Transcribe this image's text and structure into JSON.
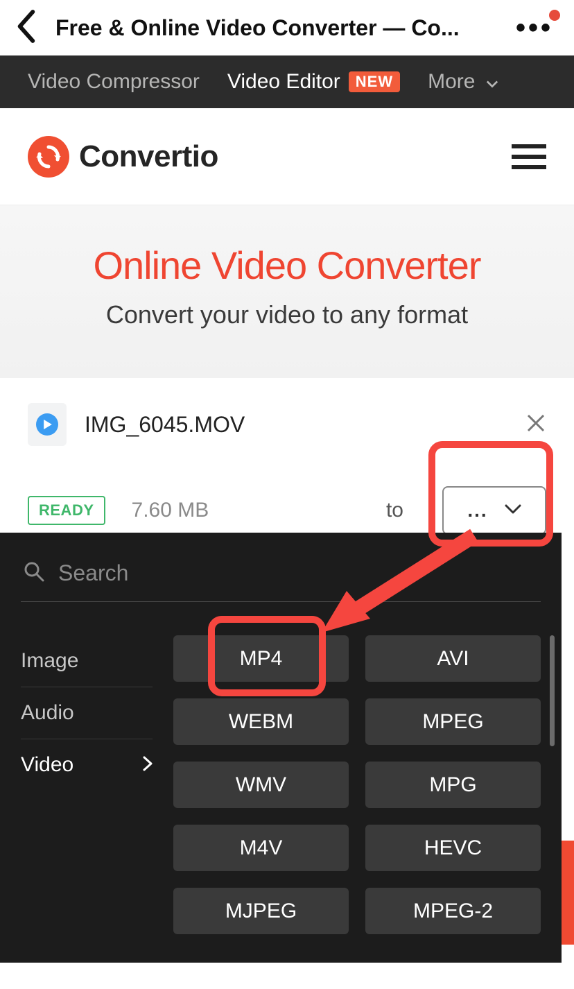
{
  "browser": {
    "title": "Free & Online Video Converter — Co..."
  },
  "topnav": {
    "item_compressor": "Video Compressor",
    "item_editor": "Video Editor",
    "badge_new": "NEW",
    "item_more": "More"
  },
  "brand": {
    "name": "Convertio"
  },
  "hero": {
    "title": "Online Video Converter",
    "subtitle": "Convert your video to any format"
  },
  "file": {
    "name": "IMG_6045.MOV",
    "status": "READY",
    "size": "7.60 MB",
    "to_label": "to",
    "select_value": "..."
  },
  "format_panel": {
    "search_placeholder": "Search",
    "categories": {
      "image": "Image",
      "audio": "Audio",
      "video": "Video"
    },
    "formats": {
      "mp4": "MP4",
      "avi": "AVI",
      "webm": "WEBM",
      "mpeg": "MPEG",
      "wmv": "WMV",
      "mpg": "MPG",
      "m4v": "M4V",
      "hevc": "HEVC",
      "mjpeg": "MJPEG",
      "mpeg2": "MPEG-2"
    }
  }
}
